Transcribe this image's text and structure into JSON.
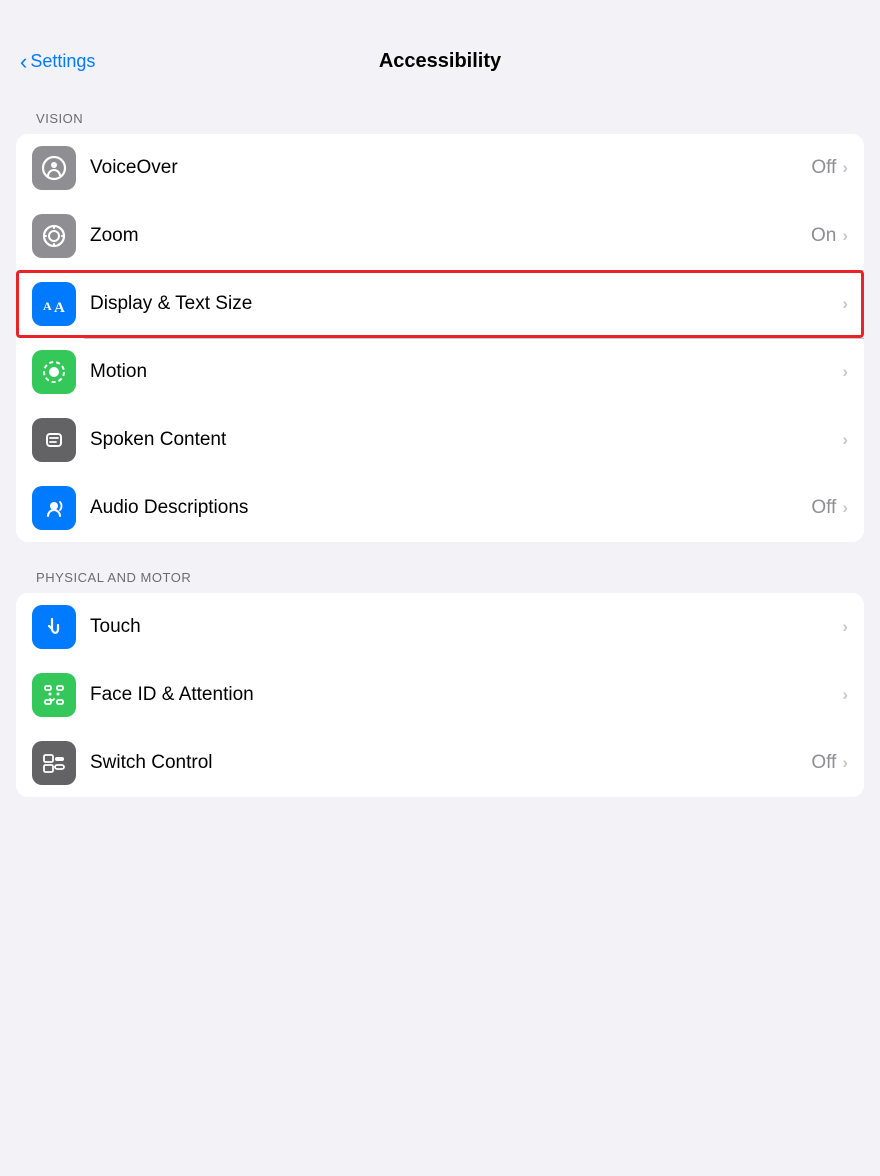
{
  "header": {
    "back_label": "Settings",
    "title": "Accessibility"
  },
  "sections": [
    {
      "id": "vision",
      "label": "VISION",
      "rows": [
        {
          "id": "voiceover",
          "label": "VoiceOver",
          "value": "Off",
          "icon_color": "gray",
          "icon_type": "voiceover",
          "highlighted": false
        },
        {
          "id": "zoom",
          "label": "Zoom",
          "value": "On",
          "icon_color": "gray",
          "icon_type": "zoom",
          "highlighted": false
        },
        {
          "id": "display-text-size",
          "label": "Display & Text Size",
          "value": "",
          "icon_color": "blue",
          "icon_type": "display",
          "highlighted": true
        },
        {
          "id": "motion",
          "label": "Motion",
          "value": "",
          "icon_color": "green",
          "icon_type": "motion",
          "highlighted": false
        },
        {
          "id": "spoken-content",
          "label": "Spoken Content",
          "value": "",
          "icon_color": "dark-gray",
          "icon_type": "spoken",
          "highlighted": false
        },
        {
          "id": "audio-descriptions",
          "label": "Audio Descriptions",
          "value": "Off",
          "icon_color": "blue",
          "icon_type": "audio",
          "highlighted": false
        }
      ]
    },
    {
      "id": "physical-motor",
      "label": "PHYSICAL AND MOTOR",
      "rows": [
        {
          "id": "touch",
          "label": "Touch",
          "value": "",
          "icon_color": "blue",
          "icon_type": "touch",
          "highlighted": false
        },
        {
          "id": "faceid",
          "label": "Face ID & Attention",
          "value": "",
          "icon_color": "green",
          "icon_type": "faceid",
          "highlighted": false
        },
        {
          "id": "switch-control",
          "label": "Switch Control",
          "value": "Off",
          "icon_color": "dark-gray",
          "icon_type": "switch",
          "highlighted": false
        }
      ]
    }
  ],
  "icons": {
    "chevron": "›",
    "back_chevron": "‹"
  }
}
